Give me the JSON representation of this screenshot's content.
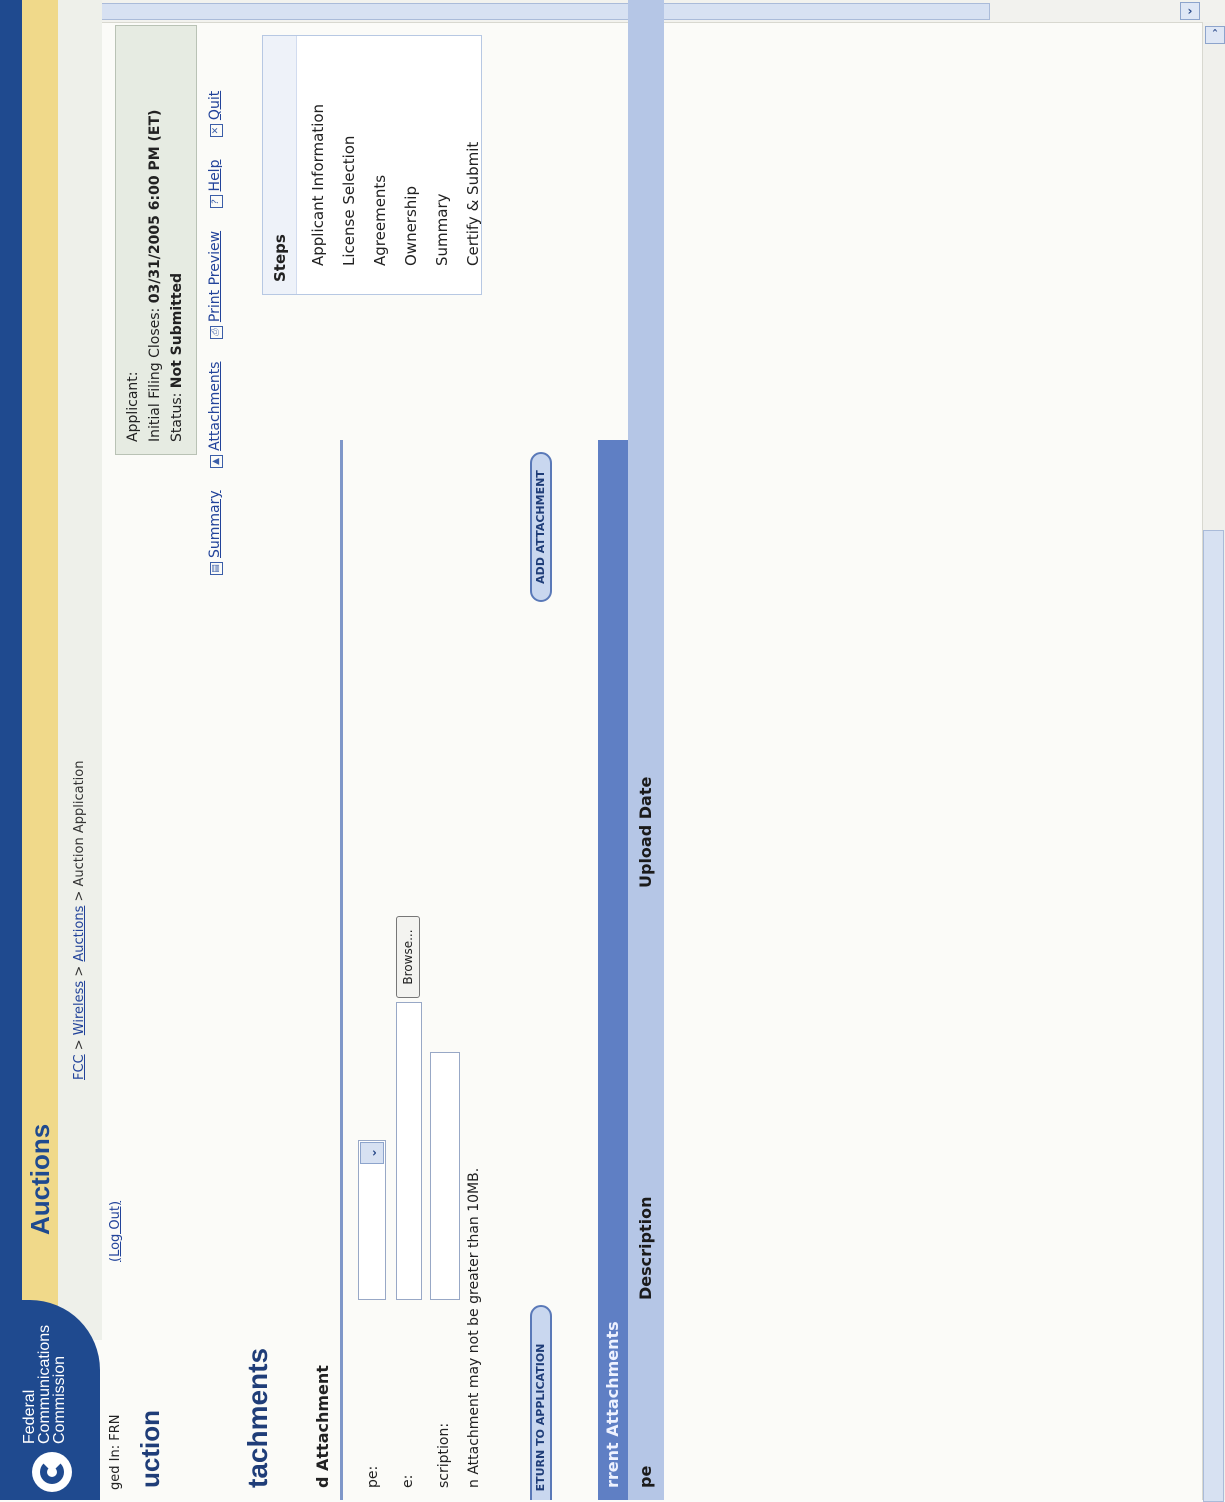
{
  "org": {
    "line1": "Federal",
    "line2": "Communications",
    "line3": "Commission"
  },
  "product": "Auctions",
  "breadcrumb": {
    "fcc": "FCC",
    "sep": " > ",
    "wireless": "Wireless",
    "auctions": "Auctions",
    "current": "Auction Application"
  },
  "logged_in": "ged In: FRN",
  "logout": "(Log Out)",
  "app_title": "uction",
  "applicant_box": {
    "applicant_label": "Applicant:",
    "filing_label": "Initial Filing Closes:",
    "filing_value": "03/31/2005 6:00 PM (ET)",
    "status_label": "Status:",
    "status_value": "Not Submitted"
  },
  "nav": {
    "summary": "Summary",
    "attachments": "Attachments",
    "print_preview": "Print Preview",
    "help": "Help",
    "quit": "Quit"
  },
  "steps": {
    "title": "Steps",
    "items": [
      "Applicant Information",
      "License Selection",
      "Agreements",
      "Ownership",
      "Summary",
      "Certify & Submit"
    ]
  },
  "section_title": "tachments",
  "add_section": {
    "title": "d Attachment",
    "type_label": "pe:",
    "file_label": "e:",
    "desc_label": "scription:",
    "browse": "Browse...",
    "note": "n Attachment may not be greater than 10MB."
  },
  "buttons": {
    "return": "ETURN TO APPLICATION",
    "add": "ADD ATTACHMENT"
  },
  "current": {
    "title": "rrent Attachments",
    "col_type": "pe",
    "col_desc": "Description",
    "col_date": "Upload Date"
  },
  "colors": {
    "fcc_blue": "#1f4a8f",
    "gold": "#f0d98a",
    "table_header": "#5f7fc4",
    "table_cols": "#b5c6e6"
  }
}
